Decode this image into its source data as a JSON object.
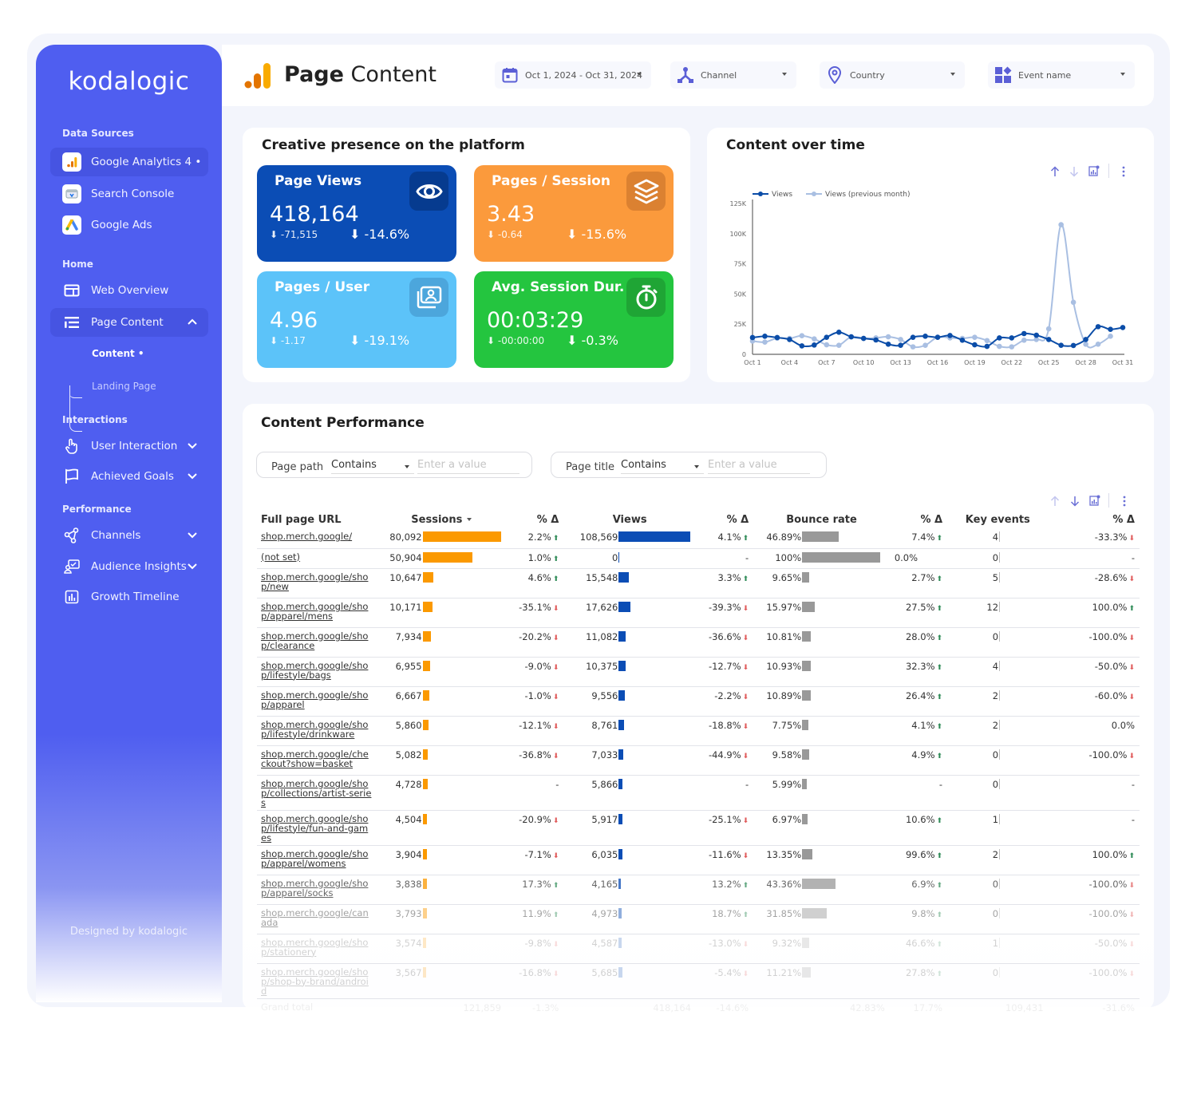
{
  "brand": {
    "name": "kodalogic",
    "footer": "Designed by kodalogic"
  },
  "sidebar": {
    "sections": [
      {
        "title": "Data Sources"
      },
      {
        "title": "Home"
      },
      {
        "title": "Interactions"
      },
      {
        "title": "Performance"
      }
    ],
    "data_sources": [
      {
        "label": "Google Analytics 4 •",
        "icon": "google-analytics-icon",
        "active": true
      },
      {
        "label": "Search Console",
        "icon": "search-console-icon"
      },
      {
        "label": "Google Ads",
        "icon": "google-ads-icon"
      }
    ],
    "home": [
      {
        "label": "Web Overview",
        "icon": "web-overview-icon"
      },
      {
        "label": "Page Content",
        "icon": "list-icon",
        "active": true,
        "expanded": true,
        "children": [
          {
            "label": "Content •",
            "active": true
          },
          {
            "label": "Landing Page"
          }
        ]
      }
    ],
    "interactions": [
      {
        "label": "User Interaction",
        "icon": "hand-pointer-icon"
      },
      {
        "label": "Achieved Goals",
        "icon": "flag-icon"
      }
    ],
    "performance": [
      {
        "label": "Channels",
        "icon": "share-nodes-icon"
      },
      {
        "label": "Audience Insights",
        "icon": "audience-icon"
      },
      {
        "label": "Growth Timeline",
        "icon": "bar-chart-icon"
      }
    ]
  },
  "header": {
    "title_bold": "Page",
    "title_rest": "Content",
    "filters": [
      {
        "label": "Oct 1, 2024 - Oct 31, 2024",
        "icon": "calendar-icon"
      },
      {
        "label": "Channel",
        "icon": "channel-icon"
      },
      {
        "label": "Country",
        "icon": "location-pin-icon"
      },
      {
        "label": "Event name",
        "icon": "event-grid-icon"
      }
    ]
  },
  "creative": {
    "title": "Creative presence on the platform",
    "kpis": [
      {
        "title": "Page Views",
        "value": "418,164",
        "delta_abs": "-71,515",
        "delta_pct": "-14.6%",
        "color": "#0b4db5",
        "icon_bg": "#063b8f"
      },
      {
        "title": "Pages / Session",
        "value": "3.43",
        "delta_abs": "-0.64",
        "delta_pct": "-15.6%",
        "color": "#fb9a3c",
        "icon_bg": "#db8131"
      },
      {
        "title": "Pages / User",
        "value": "4.96",
        "delta_abs": "-1.17",
        "delta_pct": "-19.1%",
        "color": "#5cc3f9",
        "icon_bg": "#4ca6dc"
      },
      {
        "title": "Avg. Session Dur.",
        "value": "00:03:29",
        "delta_abs": "-00:00:00",
        "delta_pct": "-0.3%",
        "color": "#24c53f",
        "icon_bg": "#1fa535"
      }
    ]
  },
  "content_over_time": {
    "title": "Content over time"
  },
  "chart_data": {
    "type": "line",
    "title": "Content over time",
    "x": [
      "Oct 1",
      "Oct 2",
      "Oct 3",
      "Oct 4",
      "Oct 5",
      "Oct 6",
      "Oct 7",
      "Oct 8",
      "Oct 9",
      "Oct 10",
      "Oct 11",
      "Oct 12",
      "Oct 13",
      "Oct 14",
      "Oct 15",
      "Oct 16",
      "Oct 17",
      "Oct 18",
      "Oct 19",
      "Oct 20",
      "Oct 21",
      "Oct 22",
      "Oct 23",
      "Oct 24",
      "Oct 25",
      "Oct 26",
      "Oct 27",
      "Oct 28",
      "Oct 29",
      "Oct 30",
      "Oct 31"
    ],
    "x_tick_labels": [
      "Oct 1",
      "Oct 4",
      "Oct 7",
      "Oct 10",
      "Oct 13",
      "Oct 16",
      "Oct 19",
      "Oct 22",
      "Oct 25",
      "Oct 28",
      "Oct 31"
    ],
    "y_tick_labels": [
      "0",
      "25K",
      "50K",
      "75K",
      "100K",
      "125K"
    ],
    "ylim": [
      0,
      125000
    ],
    "legend": "top-left",
    "grid": false,
    "series": [
      {
        "name": "Views",
        "color": "#0b4da8",
        "values": [
          13900,
          15000,
          13900,
          12300,
          7000,
          7700,
          14100,
          18300,
          14500,
          13200,
          11900,
          8400,
          7500,
          14100,
          15000,
          14100,
          15600,
          11700,
          7900,
          6600,
          13600,
          13600,
          17200,
          15800,
          12300,
          7500,
          7300,
          12300,
          22900,
          20700,
          22200
        ]
      },
      {
        "name": "Views (previous month)",
        "color": "#a9bfe2",
        "values": [
          11000,
          10100,
          13400,
          13200,
          15400,
          12800,
          7900,
          7500,
          14500,
          13200,
          13600,
          14500,
          12300,
          6200,
          7500,
          14300,
          13600,
          13200,
          14100,
          11400,
          6600,
          6200,
          11700,
          12300,
          21100,
          107400,
          43100,
          8400,
          8400,
          15000,
          null
        ]
      }
    ]
  },
  "performance": {
    "title": "Content Performance",
    "filters": [
      {
        "label": "Page path",
        "operator": "Contains",
        "placeholder": "Enter a value"
      },
      {
        "label": "Page title",
        "operator": "Contains",
        "placeholder": "Enter a value"
      }
    ],
    "columns": [
      "Full page URL",
      "Sessions",
      "% Δ",
      "Views",
      "% Δ",
      "Bounce rate",
      "% Δ",
      "Key events",
      "% Δ"
    ],
    "rows": [
      {
        "url": "shop.merch.google/",
        "sessions": "80,092",
        "s_frac": 1.0,
        "s_d": "2.2%",
        "s_dir": "up",
        "views": "108,569",
        "v_frac": 1.0,
        "v_d": "4.1%",
        "v_dir": "up",
        "bounce": "46.89%",
        "b_frac": 0.4689,
        "b_d": "7.4%",
        "b_dir": "up",
        "key": "4",
        "k_d": "-33.3%",
        "k_dir": "dn"
      },
      {
        "url": "(not set)",
        "sessions": "50,904",
        "s_frac": 0.636,
        "s_d": "1.0%",
        "s_dir": "up",
        "views": "0",
        "v_frac": 0,
        "v_d": "-",
        "v_dir": "",
        "bounce": "100%",
        "b_frac": 1.0,
        "b_d": "0.0%",
        "b_dir": "",
        "key": "0",
        "k_d": "-",
        "k_dir": ""
      },
      {
        "url": "shop.merch.google/shop/new",
        "sessions": "10,647",
        "s_frac": 0.133,
        "s_d": "4.6%",
        "s_dir": "up",
        "views": "15,548",
        "v_frac": 0.143,
        "v_d": "3.3%",
        "v_dir": "up",
        "bounce": "9.65%",
        "b_frac": 0.0965,
        "b_d": "2.7%",
        "b_dir": "up",
        "key": "5",
        "k_d": "-28.6%",
        "k_dir": "dn"
      },
      {
        "url": "shop.merch.google/shop/apparel/mens",
        "sessions": "10,171",
        "s_frac": 0.127,
        "s_d": "-35.1%",
        "s_dir": "dn",
        "views": "17,626",
        "v_frac": 0.162,
        "v_d": "-39.3%",
        "v_dir": "dn",
        "bounce": "15.97%",
        "b_frac": 0.1597,
        "b_d": "27.5%",
        "b_dir": "up",
        "key": "12",
        "k_d": "100.0%",
        "k_dir": "up"
      },
      {
        "url": "shop.merch.google/shop/clearance",
        "sessions": "7,934",
        "s_frac": 0.099,
        "s_d": "-20.2%",
        "s_dir": "dn",
        "views": "11,082",
        "v_frac": 0.102,
        "v_d": "-36.6%",
        "v_dir": "dn",
        "bounce": "10.81%",
        "b_frac": 0.1081,
        "b_d": "28.0%",
        "b_dir": "up",
        "key": "0",
        "k_d": "-100.0%",
        "k_dir": "dn"
      },
      {
        "url": "shop.merch.google/shop/lifestyle/bags",
        "sessions": "6,955",
        "s_frac": 0.087,
        "s_d": "-9.0%",
        "s_dir": "dn",
        "views": "10,375",
        "v_frac": 0.096,
        "v_d": "-12.7%",
        "v_dir": "dn",
        "bounce": "10.93%",
        "b_frac": 0.1093,
        "b_d": "32.3%",
        "b_dir": "up",
        "key": "4",
        "k_d": "-50.0%",
        "k_dir": "dn"
      },
      {
        "url": "shop.merch.google/shop/apparel",
        "sessions": "6,667",
        "s_frac": 0.083,
        "s_d": "-1.0%",
        "s_dir": "dn",
        "views": "9,556",
        "v_frac": 0.088,
        "v_d": "-2.2%",
        "v_dir": "dn",
        "bounce": "10.89%",
        "b_frac": 0.1089,
        "b_d": "26.4%",
        "b_dir": "up",
        "key": "2",
        "k_d": "-60.0%",
        "k_dir": "dn"
      },
      {
        "url": "shop.merch.google/shop/lifestyle/drinkware",
        "sessions": "5,860",
        "s_frac": 0.073,
        "s_d": "-12.1%",
        "s_dir": "dn",
        "views": "8,761",
        "v_frac": 0.081,
        "v_d": "-18.8%",
        "v_dir": "dn",
        "bounce": "7.75%",
        "b_frac": 0.0775,
        "b_d": "4.1%",
        "b_dir": "up",
        "key": "2",
        "k_d": "0.0%",
        "k_dir": ""
      },
      {
        "url": "shop.merch.google/checkout?show=basket",
        "sessions": "5,082",
        "s_frac": 0.063,
        "s_d": "-36.8%",
        "s_dir": "dn",
        "views": "7,033",
        "v_frac": 0.065,
        "v_d": "-44.9%",
        "v_dir": "dn",
        "bounce": "9.58%",
        "b_frac": 0.0958,
        "b_d": "4.9%",
        "b_dir": "up",
        "key": "0",
        "k_d": "-100.0%",
        "k_dir": "dn"
      },
      {
        "url": "shop.merch.google/shop/collections/artist-series",
        "sessions": "4,728",
        "s_frac": 0.059,
        "s_d": "-",
        "s_dir": "",
        "views": "5,866",
        "v_frac": 0.054,
        "v_d": "-",
        "v_dir": "",
        "bounce": "5.99%",
        "b_frac": 0.0599,
        "b_d": "-",
        "b_dir": "",
        "key": "0",
        "k_d": "-",
        "k_dir": ""
      },
      {
        "url": "shop.merch.google/shop/lifestyle/fun-and-games",
        "sessions": "4,504",
        "s_frac": 0.056,
        "s_d": "-20.9%",
        "s_dir": "dn",
        "views": "5,917",
        "v_frac": 0.054,
        "v_d": "-25.1%",
        "v_dir": "dn",
        "bounce": "6.97%",
        "b_frac": 0.0697,
        "b_d": "10.6%",
        "b_dir": "up",
        "key": "1",
        "k_d": "-",
        "k_dir": ""
      },
      {
        "url": "shop.merch.google/shop/apparel/womens",
        "sessions": "3,904",
        "s_frac": 0.049,
        "s_d": "-7.1%",
        "s_dir": "dn",
        "views": "6,035",
        "v_frac": 0.056,
        "v_d": "-11.6%",
        "v_dir": "dn",
        "bounce": "13.35%",
        "b_frac": 0.1335,
        "b_d": "99.6%",
        "b_dir": "up",
        "key": "2",
        "k_d": "100.0%",
        "k_dir": "up"
      },
      {
        "url": "shop.merch.google/shop/apparel/socks",
        "sessions": "3,838",
        "s_frac": 0.048,
        "s_d": "17.3%",
        "s_dir": "up",
        "views": "4,165",
        "v_frac": 0.038,
        "v_d": "13.2%",
        "v_dir": "up",
        "bounce": "43.36%",
        "b_frac": 0.4336,
        "b_d": "6.9%",
        "b_dir": "up",
        "key": "0",
        "k_d": "-100.0%",
        "k_dir": "dn"
      },
      {
        "url": "shop.merch.google/canada",
        "sessions": "3,793",
        "s_frac": 0.047,
        "s_d": "11.9%",
        "s_dir": "up",
        "views": "4,973",
        "v_frac": 0.046,
        "v_d": "18.7%",
        "v_dir": "up",
        "bounce": "31.85%",
        "b_frac": 0.3185,
        "b_d": "9.8%",
        "b_dir": "up",
        "key": "0",
        "k_d": "-100.0%",
        "k_dir": "dn"
      },
      {
        "url": "shop.merch.google/shop/stationery",
        "sessions": "3,574",
        "s_frac": 0.045,
        "s_d": "-9.8%",
        "s_dir": "dn",
        "views": "4,587",
        "v_frac": 0.042,
        "v_d": "-13.0%",
        "v_dir": "dn",
        "bounce": "9.32%",
        "b_frac": 0.0932,
        "b_d": "46.6%",
        "b_dir": "up",
        "key": "1",
        "k_d": "-50.0%",
        "k_dir": "dn"
      },
      {
        "url": "shop.merch.google/shop/shop-by-brand/android",
        "sessions": "3,567",
        "s_frac": 0.045,
        "s_d": "-16.8%",
        "s_dir": "dn",
        "views": "5,685",
        "v_frac": 0.052,
        "v_d": "-5.4%",
        "v_dir": "dn",
        "bounce": "11.21%",
        "b_frac": 0.1121,
        "b_d": "27.8%",
        "b_dir": "up",
        "key": "0",
        "k_d": "-100.0%",
        "k_dir": "dn"
      }
    ],
    "grand_total": {
      "label": "Grand total",
      "sessions": "121,859",
      "s_d": "-1.3%",
      "views": "418,164",
      "v_d": "-14.6%",
      "bounce": "42.83%",
      "b_d": "17.7%",
      "key": "109,431",
      "k_d": "-31.6%"
    },
    "colors": {
      "sessions_bar": "#fb9900",
      "views_bar": "#0b4db5",
      "bounce_bar": "#999999",
      "up": "#2e8b57",
      "down": "#e05a5a"
    }
  }
}
